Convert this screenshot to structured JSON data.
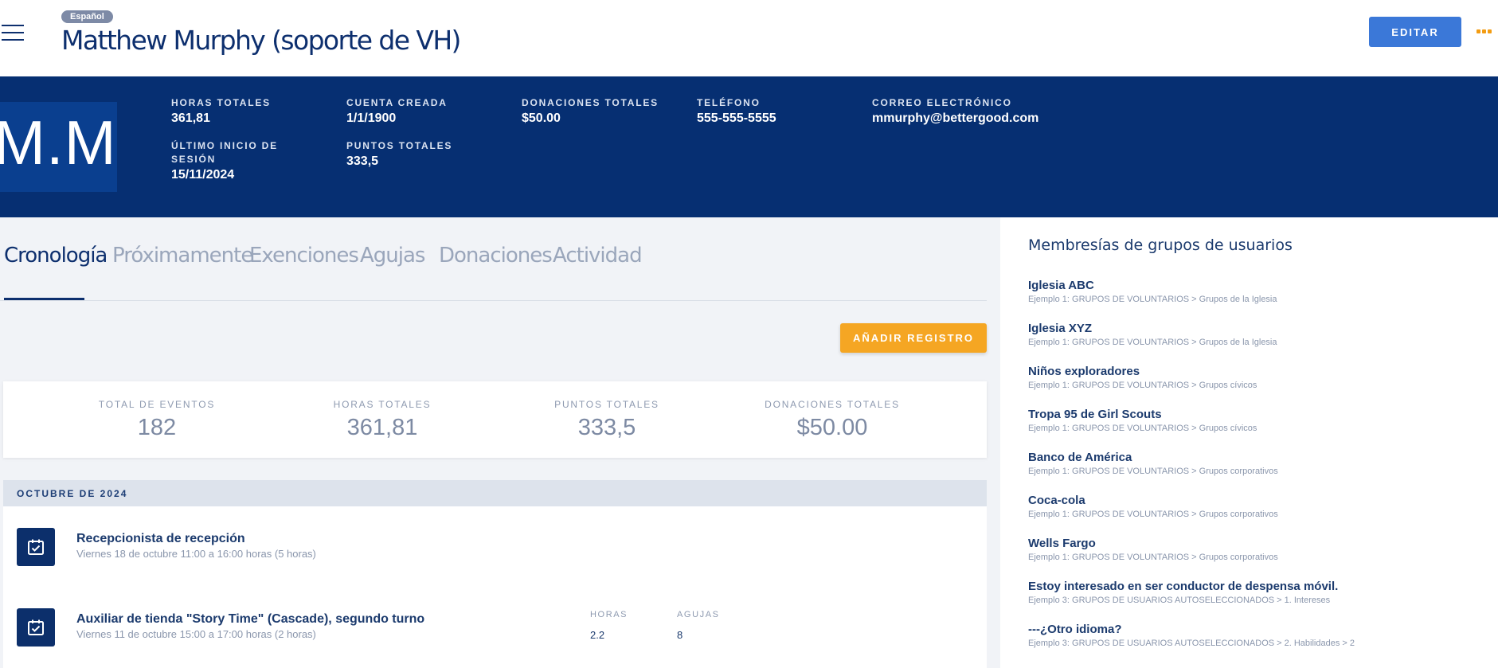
{
  "header": {
    "language_badge": "Español",
    "title": "Matthew Murphy (soporte de VH)",
    "edit_label": "EDITAR"
  },
  "profile": {
    "initials": "M.M.",
    "stats": [
      {
        "label": "HORAS TOTALES",
        "value": "361,81"
      },
      {
        "label": "CUENTA CREADA",
        "value": "1/1/1900"
      },
      {
        "label": "DONACIONES TOTALES",
        "value": "$50.00"
      },
      {
        "label": "TELÉFONO",
        "value": "555-555-5555"
      },
      {
        "label": "CORREO ELECTRÓNICO",
        "value": "mmurphy@bettergood.com"
      },
      {
        "label": "ÚLTIMO INICIO DE SESIÓN",
        "value": "15/11/2024"
      },
      {
        "label": "PUNTOS TOTALES",
        "value": "333,5"
      }
    ]
  },
  "tabs": [
    "Cronología",
    "Próximamente",
    "Exenciones",
    "Agujas",
    "Donaciones",
    "Actividad"
  ],
  "active_tab": "Cronología",
  "add_record_label": "AÑADIR REGISTRO",
  "summary": [
    {
      "label": "TOTAL DE EVENTOS",
      "value": "182"
    },
    {
      "label": "HORAS TOTALES",
      "value": "361,81"
    },
    {
      "label": "PUNTOS TOTALES",
      "value": "333,5"
    },
    {
      "label": "DONACIONES TOTALES",
      "value": "$50.00"
    }
  ],
  "timeline": {
    "month": "OCTUBRE DE 2024",
    "events": [
      {
        "title": "Recepcionista de recepción",
        "subtitle": "Viernes 18 de octubre 11:00 a 16:00 horas (5 horas)"
      },
      {
        "title": "Auxiliar de tienda \"Story Time\" (Cascade), segundo turno",
        "subtitle": "Viernes 11 de octubre 15:00 a 17:00 horas (2 horas)",
        "hours_label": "HORAS",
        "hours": "2.2",
        "needles_label": "AGUJAS",
        "needles": "8"
      }
    ]
  },
  "sidebar": {
    "title": "Membresías de grupos de usuarios",
    "groups": [
      {
        "name": "Iglesia ABC",
        "path": "Ejemplo 1: GRUPOS DE VOLUNTARIOS > Grupos de la Iglesia"
      },
      {
        "name": "Iglesia XYZ",
        "path": "Ejemplo 1: GRUPOS DE VOLUNTARIOS > Grupos de la Iglesia"
      },
      {
        "name": "Niños exploradores",
        "path": "Ejemplo 1: GRUPOS DE VOLUNTARIOS > Grupos cívicos"
      },
      {
        "name": "Tropa 95 de Girl Scouts",
        "path": "Ejemplo 1: GRUPOS DE VOLUNTARIOS > Grupos cívicos"
      },
      {
        "name": "Banco de América",
        "path": "Ejemplo 1: GRUPOS DE VOLUNTARIOS > Grupos corporativos"
      },
      {
        "name": "Coca-cola",
        "path": "Ejemplo 1: GRUPOS DE VOLUNTARIOS > Grupos corporativos"
      },
      {
        "name": "Wells Fargo",
        "path": "Ejemplo 1: GRUPOS DE VOLUNTARIOS > Grupos corporativos"
      },
      {
        "name": "Estoy interesado en ser conductor de despensa móvil.",
        "path": "Ejemplo 3: GRUPOS DE USUARIOS AUTOSELECCIONADOS > 1. Intereses"
      },
      {
        "name": "---¿Otro idioma?",
        "path": "Ejemplo 3: GRUPOS DE USUARIOS AUTOSELECCIONADOS > 2. Habilidades > 2"
      }
    ]
  },
  "icons": {
    "menu": "hamburger-menu-icon",
    "more": "more-options-icon",
    "event": "calendar-check-icon"
  },
  "colors": {
    "brand_navy": "#062f72",
    "accent_blue": "#3b78d8",
    "accent_orange": "#f5a623"
  }
}
